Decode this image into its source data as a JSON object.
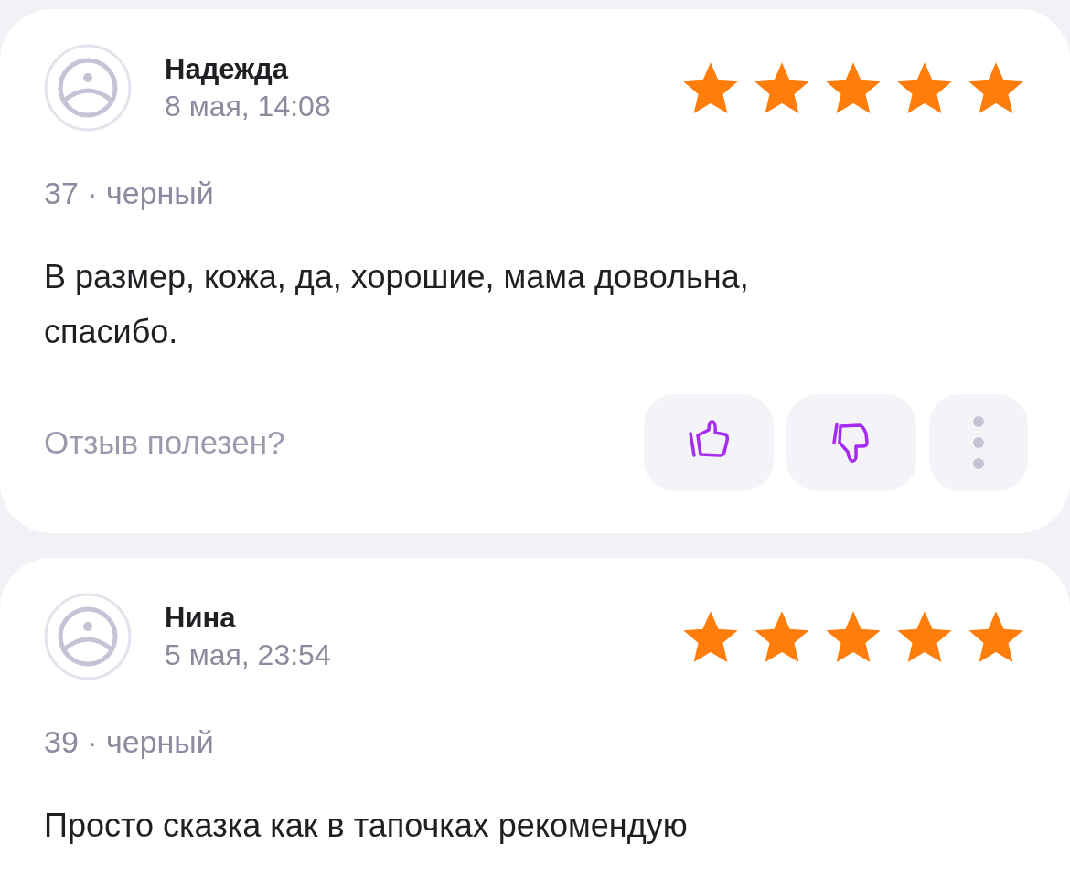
{
  "reviews": [
    {
      "author": "Надежда",
      "date": "8 мая, 14:08",
      "stars": 5,
      "variant": "37 · черный",
      "text": "В размер, кожа, да, хорошие, мама довольна, спасибо.",
      "helpful": {
        "label": "Отзыв полезен?"
      }
    },
    {
      "author": "Нина",
      "date": "5 мая, 23:54",
      "stars": 5,
      "variant": "39 · черный",
      "text": "Просто сказка как в тапочках рекомендую"
    }
  ]
}
